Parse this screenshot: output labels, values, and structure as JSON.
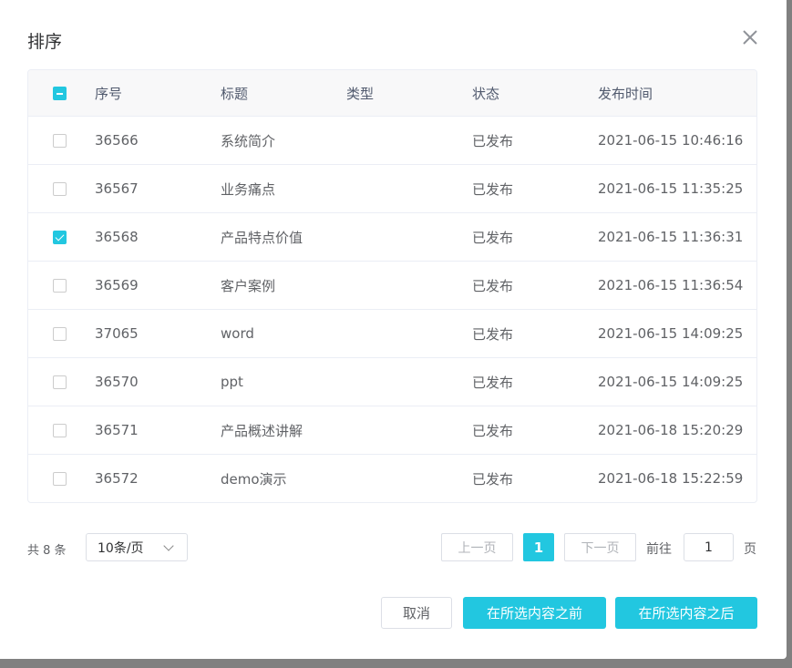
{
  "dialog": {
    "title": "排序",
    "close_icon": "close-icon"
  },
  "table": {
    "headers": [
      "序号",
      "标题",
      "类型",
      "状态",
      "发布时间"
    ],
    "rows": [
      {
        "id": "36566",
        "title": "系统简介",
        "type": "",
        "status": "已发布",
        "time": "2021-06-15 10:46:16",
        "checked": false
      },
      {
        "id": "36567",
        "title": "业务痛点",
        "type": "",
        "status": "已发布",
        "time": "2021-06-15 11:35:25",
        "checked": false
      },
      {
        "id": "36568",
        "title": "产品特点价值",
        "type": "",
        "status": "已发布",
        "time": "2021-06-15 11:36:31",
        "checked": true
      },
      {
        "id": "36569",
        "title": "客户案例",
        "type": "",
        "status": "已发布",
        "time": "2021-06-15 11:36:54",
        "checked": false
      },
      {
        "id": "37065",
        "title": "word",
        "type": "",
        "status": "已发布",
        "time": "2021-06-15 14:09:25",
        "checked": false
      },
      {
        "id": "36570",
        "title": "ppt",
        "type": "",
        "status": "已发布",
        "time": "2021-06-15 14:09:25",
        "checked": false
      },
      {
        "id": "36571",
        "title": "产品概述讲解",
        "type": "",
        "status": "已发布",
        "time": "2021-06-18 15:20:29",
        "checked": false
      },
      {
        "id": "36572",
        "title": "demo演示",
        "type": "",
        "status": "已发布",
        "time": "2021-06-18 15:22:59",
        "checked": false
      }
    ]
  },
  "pagination": {
    "total": "共 8 条",
    "page_size": "10条/页",
    "prev": "上一页",
    "current": "1",
    "next": "下一页",
    "goto_label": "前往",
    "goto_value": "1",
    "page_suffix": "页"
  },
  "footer": {
    "cancel": "取消",
    "before": "在所选内容之前",
    "after": "在所选内容之后"
  },
  "colors": {
    "accent": "#22c7e0"
  }
}
